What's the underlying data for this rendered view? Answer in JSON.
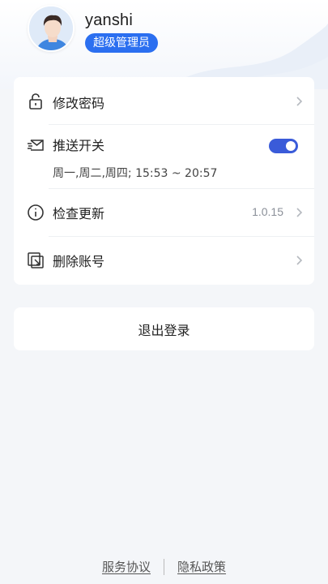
{
  "profile": {
    "username": "yanshi",
    "role": "超级管理员"
  },
  "menu": {
    "change_password": {
      "label": "修改密码",
      "icon": "unlock-icon"
    },
    "push": {
      "label": "推送开关",
      "icon": "mail-icon",
      "enabled": true,
      "schedule": "周一,周二,周四; 15:53 ~ 20:57"
    },
    "update": {
      "label": "检查更新",
      "icon": "info-icon",
      "version": "1.0.15"
    },
    "delete_account": {
      "label": "删除账号",
      "icon": "delete-account-icon"
    }
  },
  "logout": {
    "label": "退出登录"
  },
  "footer": {
    "service_agreement": "服务协议",
    "privacy_policy": "隐私政策"
  },
  "colors": {
    "accent": "#2b6ff0",
    "toggle_on": "#3a5bd9",
    "background": "#f4f6f9"
  }
}
